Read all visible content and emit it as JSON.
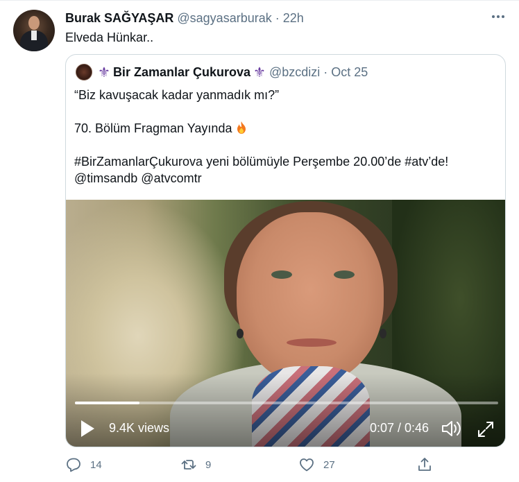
{
  "tweet": {
    "author_name": "Burak SAĞYAŞAR",
    "author_handle": "@sagyasarburak",
    "separator": "·",
    "time": "22h",
    "text": "Elveda Hünkar..",
    "more_icon": "more-horizontal-icon"
  },
  "quote": {
    "author_name": "Bir Zamanlar Çukurova",
    "decoration_left": "⚜",
    "decoration_right": "⚜",
    "author_handle": "@bzcdizi",
    "separator": "·",
    "time": "Oct 25",
    "line1": "“Biz kavuşacak kadar yanmadık mı?”",
    "line2": "70. Bölüm Fragman Yayında",
    "line2_emoji": "fire-emoji",
    "line3": "#BirZamanlarÇukurova yeni bölümüyle Perşembe 20.00’de #atv’de!",
    "line4": "@timsandb @atvcomtr",
    "video": {
      "views": "9.4K views",
      "time": "0:07 / 0:46",
      "progress_fraction": 0.152,
      "play_icon": "play-icon",
      "volume_icon": "volume-icon",
      "fullscreen_icon": "fullscreen-icon"
    }
  },
  "actions": {
    "reply_count": "14",
    "retweet_count": "9",
    "like_count": "27",
    "icons": [
      "reply-icon",
      "retweet-icon",
      "like-icon",
      "share-icon"
    ]
  },
  "colors": {
    "text": "#0f1419",
    "muted": "#5b7083",
    "border": "#cfd9de",
    "fleur": "#6a3ea1"
  }
}
